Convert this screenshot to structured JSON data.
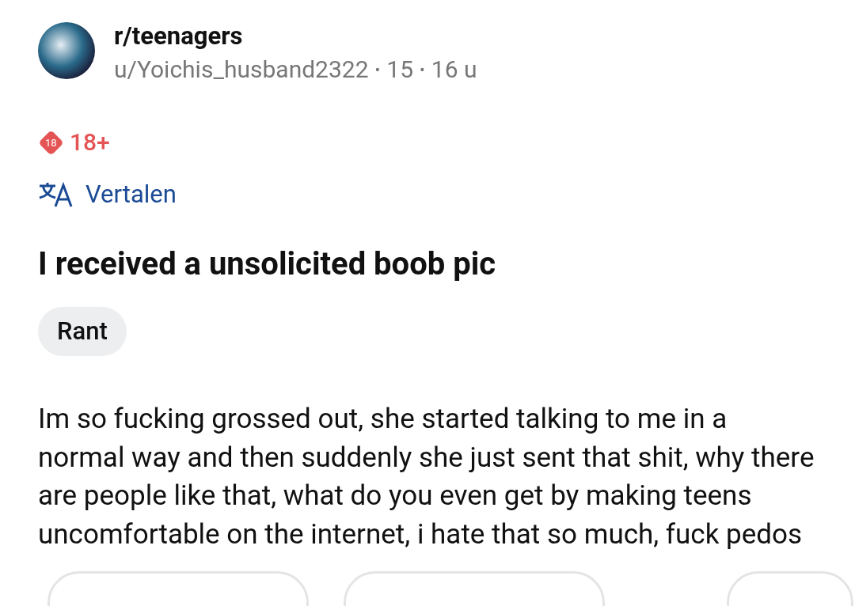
{
  "post": {
    "subreddit": "r/teenagers",
    "author": "u/Yoichis_husband2322",
    "separator_1": "•",
    "flair_author": "15",
    "separator_2": "•",
    "age": "16 u",
    "nsfw_badge": {
      "icon_text": "18",
      "label": "18+"
    },
    "translate": "Vertalen",
    "title": "I received a unsolicited boob pic",
    "flair": "Rant",
    "body": "Im so fucking grossed out, she started talking to me in a normal way and then suddenly she just sent that shit, why there are people like that, what do you even get by making teens uncomfortable on the internet, i hate that so much, fuck pedos",
    "actions": [
      {
        "kind": "pill"
      },
      {
        "kind": "pill"
      },
      {
        "kind": "pill"
      }
    ]
  }
}
